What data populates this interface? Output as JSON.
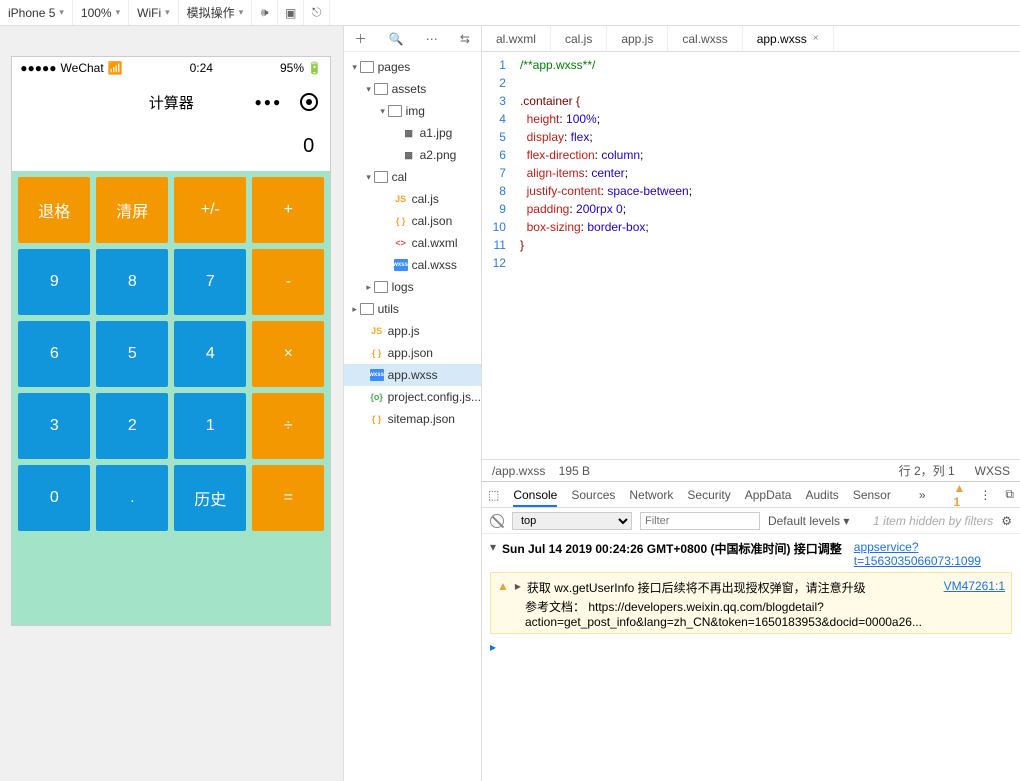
{
  "topbar": {
    "device": "iPhone 5",
    "zoom": "100%",
    "network": "WiFi",
    "sim": "模拟操作"
  },
  "phone": {
    "carrier": "WeChat",
    "time": "0:24",
    "battery": "95%",
    "title": "计算器",
    "display": "0"
  },
  "keys": [
    {
      "label": "退格",
      "c": "orange"
    },
    {
      "label": "清屏",
      "c": "orange"
    },
    {
      "label": "+/-",
      "c": "orange"
    },
    {
      "label": "+",
      "c": "orange"
    },
    {
      "label": "9",
      "c": "blue"
    },
    {
      "label": "8",
      "c": "blue"
    },
    {
      "label": "7",
      "c": "blue"
    },
    {
      "label": "-",
      "c": "orange"
    },
    {
      "label": "6",
      "c": "blue"
    },
    {
      "label": "5",
      "c": "blue"
    },
    {
      "label": "4",
      "c": "blue"
    },
    {
      "label": "×",
      "c": "orange"
    },
    {
      "label": "3",
      "c": "blue"
    },
    {
      "label": "2",
      "c": "blue"
    },
    {
      "label": "1",
      "c": "blue"
    },
    {
      "label": "÷",
      "c": "orange"
    },
    {
      "label": "0",
      "c": "blue"
    },
    {
      "label": ".",
      "c": "blue"
    },
    {
      "label": "历史",
      "c": "blue"
    },
    {
      "label": "=",
      "c": "orange"
    }
  ],
  "tree": {
    "pages": "pages",
    "assets": "assets",
    "img": "img",
    "a1": "a1.jpg",
    "a2": "a2.png",
    "cal": "cal",
    "caljs": "cal.js",
    "caljson": "cal.json",
    "calwxml": "cal.wxml",
    "calwxss": "cal.wxss",
    "logs": "logs",
    "utils": "utils",
    "appjs": "app.js",
    "appjson": "app.json",
    "appwxss": "app.wxss",
    "project": "project.config.js...",
    "sitemap": "sitemap.json"
  },
  "tabs": [
    "al.wxml",
    "cal.js",
    "app.js",
    "cal.wxss",
    "app.wxss"
  ],
  "code": {
    "l1": "/**app.wxss**/",
    "l3": ".container {",
    "l4a": "  height",
    "l4b": ": ",
    "l4c": "100%",
    "l4d": ";",
    "l5a": "  display",
    "l5b": ": ",
    "l5c": "flex",
    "l5d": ";",
    "l6a": "  flex-direction",
    "l6b": ": ",
    "l6c": "column",
    "l6d": ";",
    "l7a": "  align-items",
    "l7b": ": ",
    "l7c": "center",
    "l7d": ";",
    "l8a": "  justify-content",
    "l8b": ": ",
    "l8c": "space-between",
    "l8d": ";",
    "l9a": "  padding",
    "l9b": ": ",
    "l9c": "200rpx 0",
    "l9d": ";",
    "l10a": "  box-sizing",
    "l10b": ": ",
    "l10c": "border-box",
    "l10d": ";",
    "l11": "}"
  },
  "status": {
    "path": "/app.wxss",
    "size": "195 B",
    "pos": "行 2，列 1",
    "lang": "WXSS"
  },
  "devtabs": [
    "Console",
    "Sources",
    "Network",
    "Security",
    "AppData",
    "Audits",
    "Sensor"
  ],
  "warnCount": "1",
  "filter": {
    "ctx": "top",
    "ph": "Filter",
    "level": "Default levels",
    "hidden": "1 item hidden by filters"
  },
  "console": {
    "ts": "Sun Jul 14 2019 00:24:26 GMT+0800 (中国标准时间) 接口调整",
    "link1": "appservice?t=1563035066073:1099",
    "warn": "获取 wx.getUserInfo 接口后续将不再出现授权弹窗，请注意升级",
    "warn2": "参考文档：",
    "warnlink": "https://developers.weixin.qq.com/blogdetail?action=get_post_info&lang=zh_CN&token=1650183953&docid=0000a26...",
    "vm": "VM47261:1"
  }
}
